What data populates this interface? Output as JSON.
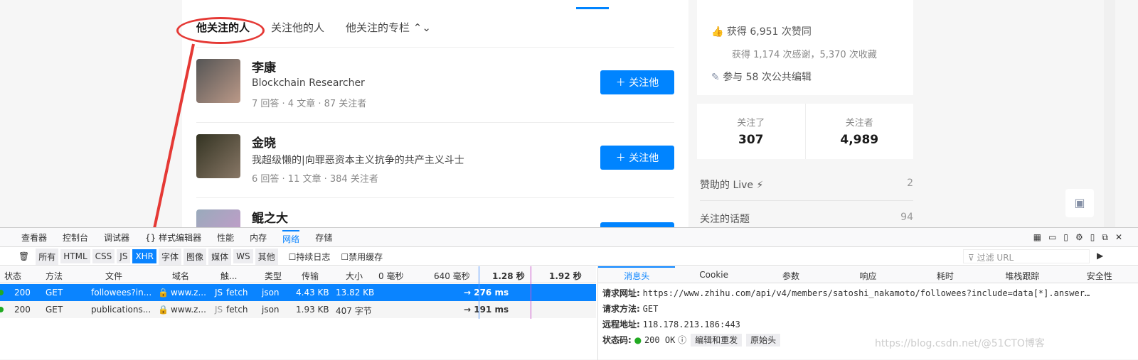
{
  "tabs": [
    "他关注的人",
    "关注他的人",
    "他关注的专栏 ⌃⌄"
  ],
  "people": [
    {
      "name": "李康",
      "desc": "Blockchain Researcher",
      "stats": "7 回答 · 4 文章 · 87 关注者",
      "button": "＋ 关注他"
    },
    {
      "name": "金晓",
      "desc": "我超级懒的|向罪恶资本主义抗争的共产主义斗士",
      "stats": "6 回答 · 11 文章 · 384 关注者",
      "button": "＋ 关注他"
    },
    {
      "name": "鲲之大",
      "desc": "",
      "stats": "",
      "button": ""
    }
  ],
  "side": {
    "likes": "获得 6,951 次赞同",
    "thanks": "获得 1,174 次感谢，5,370 次收藏",
    "edits": "参与 58 次公共编辑",
    "following_label": "关注了",
    "following": "307",
    "followers_label": "关注者",
    "followers": "4,989",
    "live_label": "赞助的 Live ⚡",
    "live": "2",
    "topics_label": "关注的话题",
    "topics": "94"
  },
  "devtools": {
    "tools": [
      "查看器",
      "控制台",
      "调试器",
      "{} 样式编辑器",
      "性能",
      "内存",
      "网络",
      "存储"
    ],
    "filters": [
      "所有",
      "HTML",
      "CSS",
      "JS",
      "XHR",
      "字体",
      "图像",
      "媒体",
      "WS",
      "其他"
    ],
    "persist": "持续日志",
    "disable_cache": "禁用缓存",
    "filter_placeholder": "过滤 URL",
    "columns": [
      "状态",
      "方法",
      "文件",
      "域名",
      "触...",
      "类型",
      "传输",
      "大小",
      "0 毫秒",
      "640 毫秒",
      "1.28 秒",
      "1.92 秒"
    ],
    "rows": [
      {
        "status": "200",
        "method": "GET",
        "file": "followees?in...",
        "domain": "www.z...",
        "cause": "fetch",
        "type": "json",
        "transfer": "4.43 KB",
        "size": "13.82 KB",
        "time": "→ 276 ms"
      },
      {
        "status": "200",
        "method": "GET",
        "file": "publications...",
        "domain": "www.z...",
        "cause": "fetch",
        "type": "json",
        "transfer": "1.93 KB",
        "size": "407 字节",
        "time": "→ 191 ms"
      }
    ],
    "detail_tabs": [
      "消息头",
      "Cookie",
      "参数",
      "响应",
      "耗时",
      "堆栈跟踪",
      "安全性"
    ],
    "url_label": "请求网址:",
    "url": "https://www.zhihu.com/api/v4/members/satoshi_nakamoto/followees?include=data[*].answer…",
    "method_label": "请求方法:",
    "method": "GET",
    "remote_label": "远程地址:",
    "remote": "118.178.213.186:443",
    "status_label": "状态码:",
    "status": "200 OK",
    "edit_resend": "编辑和重发",
    "raw_headers": "原始头"
  },
  "watermark": "https://blog.csdn.net/@51CTO博客"
}
